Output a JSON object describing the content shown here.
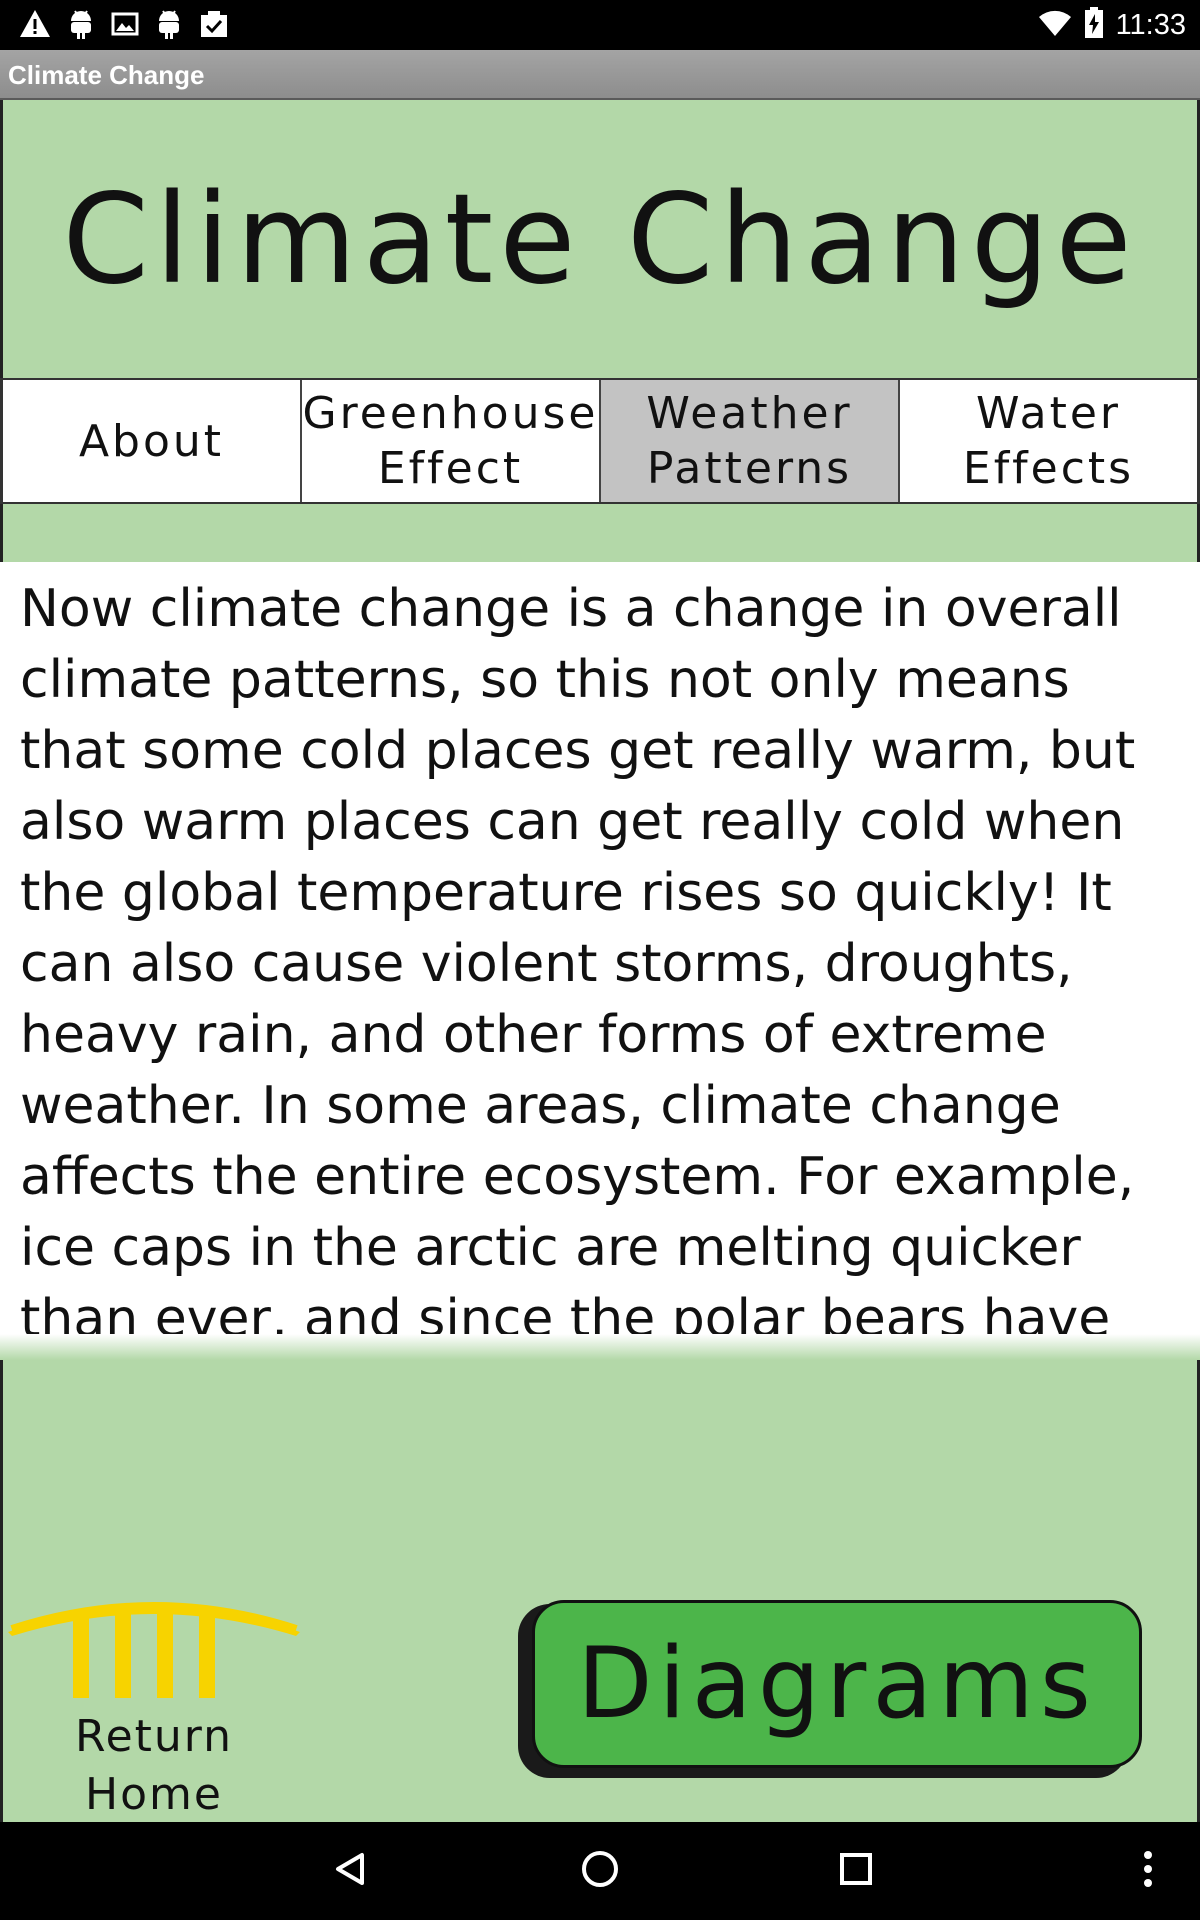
{
  "status_bar": {
    "time": "11:33",
    "left_icons": [
      "warning-icon",
      "android-icon",
      "image-icon",
      "android-icon",
      "clipboard-check-icon"
    ],
    "right_icons": [
      "wifi-icon",
      "battery-charging-icon"
    ]
  },
  "app_bar": {
    "title": "Climate Change"
  },
  "hero": {
    "title": "Climate Change"
  },
  "tabs": [
    {
      "label": "About",
      "active": false
    },
    {
      "label": "Greenhouse\nEffect",
      "active": false
    },
    {
      "label": "Weather\nPatterns",
      "active": true
    },
    {
      "label": "Water\nEffects",
      "active": false
    }
  ],
  "content": {
    "body": "Now climate change is a change in overall climate patterns, so this not only means that some cold places get really warm, but also warm places can get really cold when the global temperature rises so quickly! It can also cause violent storms, droughts, heavy rain, and other forms of extreme weather.  In some areas, climate change affects the entire ecosystem. For example, ice caps in the arctic are melting quicker than ever, and since the polar bears have"
  },
  "return_home": {
    "label": "Return\nHome",
    "icon": "temple-icon",
    "color": "#f7d300"
  },
  "diagrams_button": {
    "label": "Diagrams",
    "color": "#4cb54a"
  },
  "nav_bar": {
    "icons": [
      "back-icon",
      "home-icon",
      "recents-icon",
      "menu-icon"
    ]
  }
}
